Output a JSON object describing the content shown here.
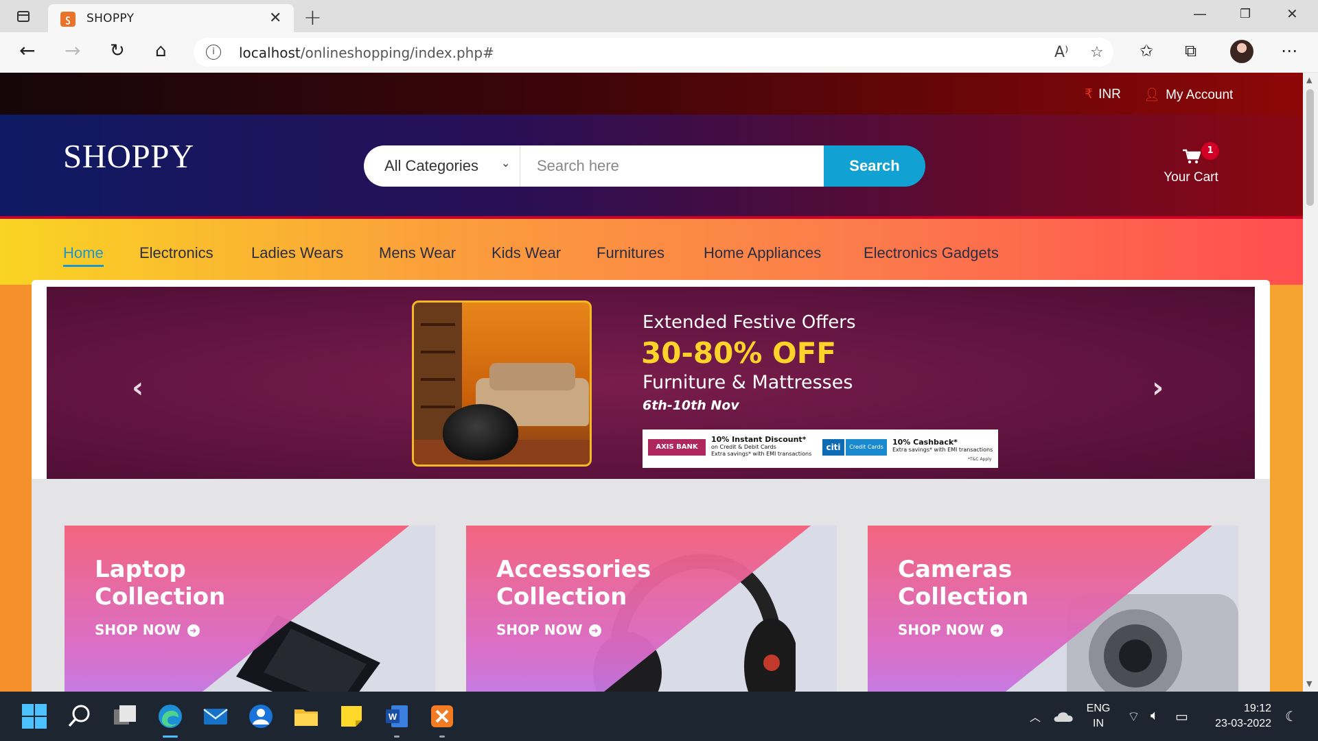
{
  "browser": {
    "tab_title": "SHOPPY",
    "url_host": "localhost",
    "url_path": "/onlineshopping/index.php#"
  },
  "top_header": {
    "currency": "INR",
    "account": "My Account"
  },
  "header": {
    "logo": "SHOPPY",
    "category_select": "All Categories",
    "search_placeholder": "Search here",
    "search_button": "Search",
    "cart_count": "1",
    "cart_label": "Your Cart"
  },
  "nav": {
    "items": [
      "Home",
      "Electronics",
      "Ladies Wears",
      "Mens Wear",
      "Kids Wear",
      "Furnitures",
      "Home Appliances",
      "Electronics Gadgets"
    ],
    "active": "Home"
  },
  "banner": {
    "title": "Extended Festive Offers",
    "discount": "30-80% OFF",
    "subtitle": "Furniture & Mattresses",
    "dates": "6th-10th Nov",
    "bank1_name": "AXIS BANK",
    "bank1_offer": "10% Instant Discount*",
    "bank1_detail1": "on Credit & Debit Cards",
    "bank1_detail2": "Extra savings* with EMI transactions",
    "bank2_name": "citi",
    "bank2_cards": "Credit Cards",
    "bank2_offer": "10% Cashback*",
    "bank2_detail": "Extra savings* with EMI transactions",
    "tc": "*T&C Apply"
  },
  "collections": [
    {
      "title_line1": "Laptop",
      "title_line2": "Collection",
      "link": "SHOP NOW"
    },
    {
      "title_line1": "Accessories",
      "title_line2": "Collection",
      "link": "SHOP NOW"
    },
    {
      "title_line1": "Cameras",
      "title_line2": "Collection",
      "link": "SHOP NOW"
    }
  ],
  "taskbar": {
    "lang_line1": "ENG",
    "lang_line2": "IN",
    "time": "19:12",
    "date": "23-03-2022"
  },
  "colors": {
    "brand_red": "#d10024",
    "search_blue": "#11a2d3",
    "nav_active": "#1f95c8",
    "offer_yellow": "#ffd32a"
  }
}
